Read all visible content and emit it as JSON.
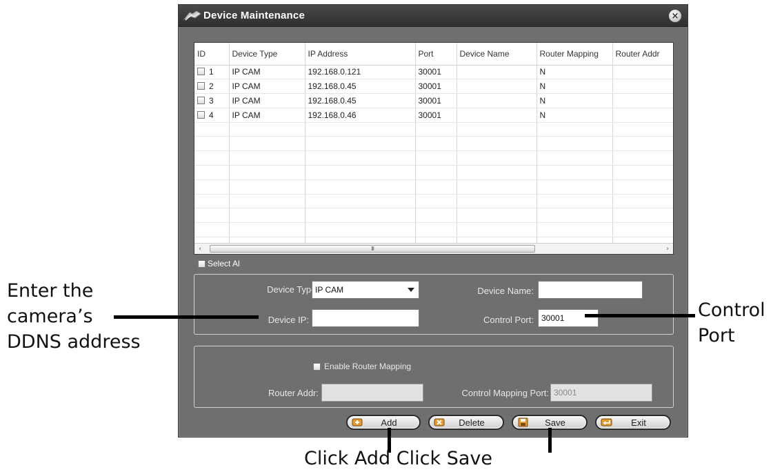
{
  "window": {
    "title": "Device Maintenance",
    "close": "×"
  },
  "table": {
    "columns": [
      "ID",
      "Device Type",
      "IP Address",
      "Port",
      "Device Name",
      "Router Mapping",
      "Router Addr"
    ],
    "rows": [
      {
        "id": "1",
        "type": "IP CAM",
        "ip": "192.168.0.121",
        "port": "30001",
        "name": "",
        "mapping": "N",
        "raddr": ""
      },
      {
        "id": "2",
        "type": "IP CAM",
        "ip": "192.168.0.45",
        "port": "30001",
        "name": "",
        "mapping": "N",
        "raddr": ""
      },
      {
        "id": "3",
        "type": "IP CAM",
        "ip": "192.168.0.45",
        "port": "30001",
        "name": "",
        "mapping": "N",
        "raddr": ""
      },
      {
        "id": "4",
        "type": "IP CAM",
        "ip": "192.168.0.46",
        "port": "30001",
        "name": "",
        "mapping": "N",
        "raddr": ""
      }
    ],
    "scroll_left": "‹",
    "scroll_right": "›",
    "scroll_grip": "III"
  },
  "select_all_label": "Select Al",
  "form": {
    "device_type_label": "Device Type:",
    "device_type_value": "IP CAM",
    "device_name_label": "Device Name:",
    "device_name_value": "",
    "device_ip_label": "Device IP:",
    "device_ip_value": "",
    "control_port_label": "Control Port:",
    "control_port_value": "30001"
  },
  "router": {
    "enable_label": "Enable Router Mapping",
    "router_addr_label": "Router Addr:",
    "router_addr_value": "",
    "control_mapping_label": "Control Mapping Port:",
    "control_mapping_value": "30001"
  },
  "buttons": {
    "add": "Add",
    "delete": "Delete",
    "save": "Save",
    "exit": "Exit"
  },
  "annotations": {
    "left_1": "Enter the",
    "left_2": "camera’s",
    "left_3": "DDNS address",
    "right_1": "Control",
    "right_2": "Port",
    "bottom": "Click Add Click Save"
  }
}
